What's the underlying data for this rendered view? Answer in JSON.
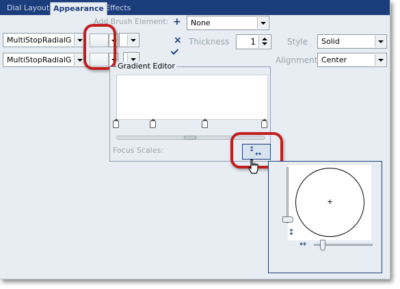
{
  "tabs": [
    {
      "label": "Dial Layout",
      "active": false
    },
    {
      "label": "Appearance",
      "active": true
    },
    {
      "label": "Effects",
      "active": false
    }
  ],
  "brush_rows": [
    {
      "brush_type": "MultiStopRadialG"
    },
    {
      "brush_type": "MultiStopRadialG"
    }
  ],
  "add_brush": {
    "label": "Add Brush Element:",
    "add_symbol": "+",
    "remove_symbol": "×",
    "value": "None"
  },
  "thickness": {
    "label": "Thickness",
    "value": "1"
  },
  "style": {
    "label": "Style",
    "value": "Solid"
  },
  "alignment": {
    "label": "Alignment",
    "value": "Center"
  },
  "gradient_editor": {
    "title": "Gradient Editor",
    "focus_scales_label": "Focus Scales:",
    "stop_count": 4
  },
  "focus_popup": {
    "marker": "+",
    "vertical_arrow": "↕",
    "horizontal_arrow": "↔"
  },
  "colors": {
    "highlight_ring": "#c21d1d",
    "header": "#1c3d7c",
    "panel_bg": "#e7edf3"
  }
}
